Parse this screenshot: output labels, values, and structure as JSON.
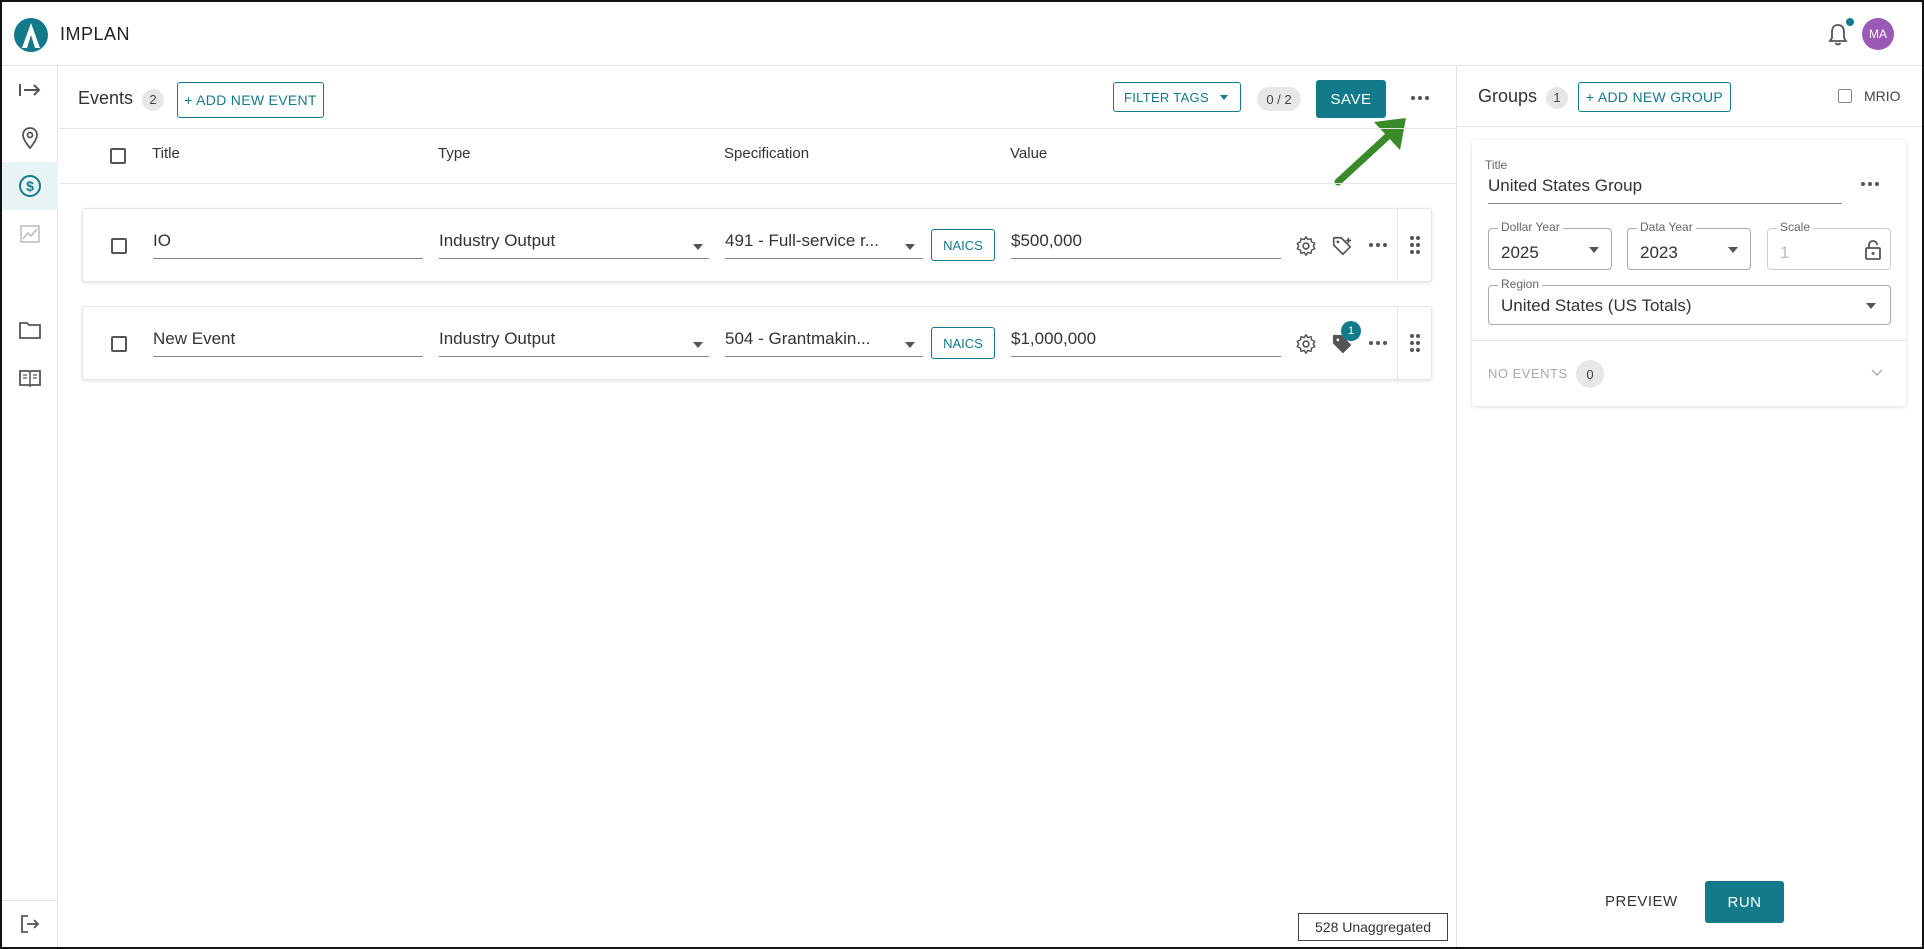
{
  "app": {
    "brand": "IMPLAN",
    "user_initials": "MA",
    "accent_color": "#137a8c",
    "avatar_color": "#9b59b6"
  },
  "sidebar": {
    "items": [
      {
        "icon": "expand-arrow-icon"
      },
      {
        "icon": "location-pin-icon"
      },
      {
        "icon": "dollar-circle-icon",
        "active": true
      },
      {
        "icon": "chart-icon"
      },
      {
        "icon": "folder-icon"
      },
      {
        "icon": "book-icon"
      }
    ],
    "bottom_icon": "logout-icon"
  },
  "events": {
    "title": "Events",
    "count": "2",
    "add_label": "+ ADD NEW EVENT",
    "filter_tags_label": "FILTER TAGS",
    "selection_count": "0 / 2",
    "save_label": "SAVE",
    "columns": [
      "Title",
      "Type",
      "Specification",
      "Value"
    ],
    "rows": [
      {
        "title": "IO",
        "type": "Industry Output",
        "specification": "491 - Full-service r...",
        "naics": "NAICS",
        "value": "$500,000",
        "tag_count": ""
      },
      {
        "title": "New Event",
        "type": "Industry Output",
        "specification": "504 - Grantmakin...",
        "naics": "NAICS",
        "value": "$1,000,000",
        "tag_count": "1"
      }
    ]
  },
  "groups": {
    "title": "Groups",
    "count": "1",
    "add_label": "+ ADD NEW GROUP",
    "mrio_label": "MRIO",
    "card": {
      "title_label": "Title",
      "title_value": "United States Group",
      "dollar_year_label": "Dollar Year",
      "dollar_year_value": "2025",
      "data_year_label": "Data Year",
      "data_year_value": "2023",
      "scale_label": "Scale",
      "scale_value": "1",
      "region_label": "Region",
      "region_value": "United States (US Totals)",
      "no_events_label": "NO EVENTS",
      "no_events_count": "0"
    }
  },
  "footer": {
    "preview_label": "PREVIEW",
    "run_label": "RUN",
    "status_text": "528 Unaggregated"
  }
}
